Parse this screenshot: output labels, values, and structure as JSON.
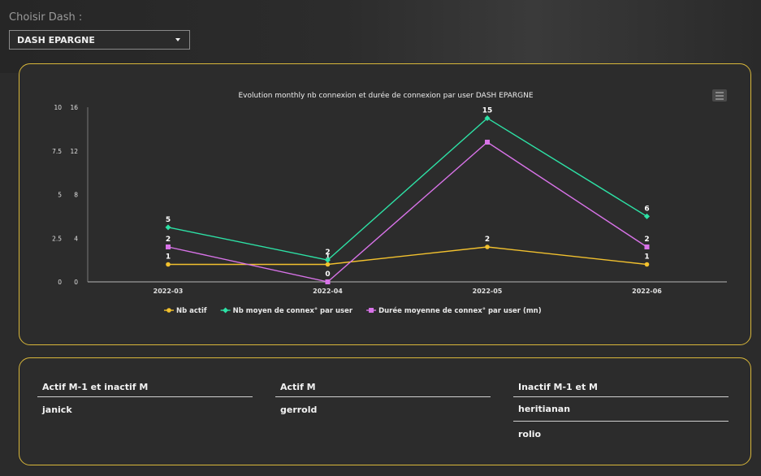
{
  "selector": {
    "label": "Choisir Dash :",
    "value": "DASH EPARGNE"
  },
  "chart_data": {
    "type": "line",
    "title": "Evolution monthly nb connexion et durée de connexion par user DASH EPARGNE",
    "categories": [
      "2022-03",
      "2022-04",
      "2022-05",
      "2022-06"
    ],
    "left_axis_ticks": [
      "10",
      "7.5",
      "5",
      "2.5",
      "0"
    ],
    "right_axis_ticks": [
      "16",
      "12",
      "8",
      "4",
      "0"
    ],
    "y_left_range": [
      0,
      10
    ],
    "y_right_range": [
      0,
      16
    ],
    "series": [
      {
        "name": "Nb actif",
        "color": "#f2c12e",
        "marker": "circle",
        "axis": "left",
        "values": [
          1,
          1,
          2,
          1
        ],
        "labels": [
          "1",
          "1",
          "2",
          "1"
        ]
      },
      {
        "name": "Nb moyen de connex° par user",
        "color": "#2de2a6",
        "marker": "diamond",
        "axis": "right",
        "values": [
          5,
          2,
          15,
          6
        ],
        "labels": [
          "5",
          "2",
          "15",
          "6"
        ]
      },
      {
        "name": "Durée moyenne de connex° par user (mn)",
        "color": "#d873e8",
        "marker": "square",
        "axis": "left",
        "values": [
          2,
          0,
          8,
          2
        ],
        "labels": [
          "2",
          "0",
          "",
          "2"
        ]
      }
    ],
    "legend_position": "bottom"
  },
  "tables": [
    {
      "header": "Actif M-1 et inactif M",
      "rows": [
        "janick"
      ]
    },
    {
      "header": "Actif M",
      "rows": [
        "gerrold"
      ]
    },
    {
      "header": "Inactif M-1 et M",
      "rows": [
        "heritianan",
        "rolio"
      ]
    }
  ]
}
